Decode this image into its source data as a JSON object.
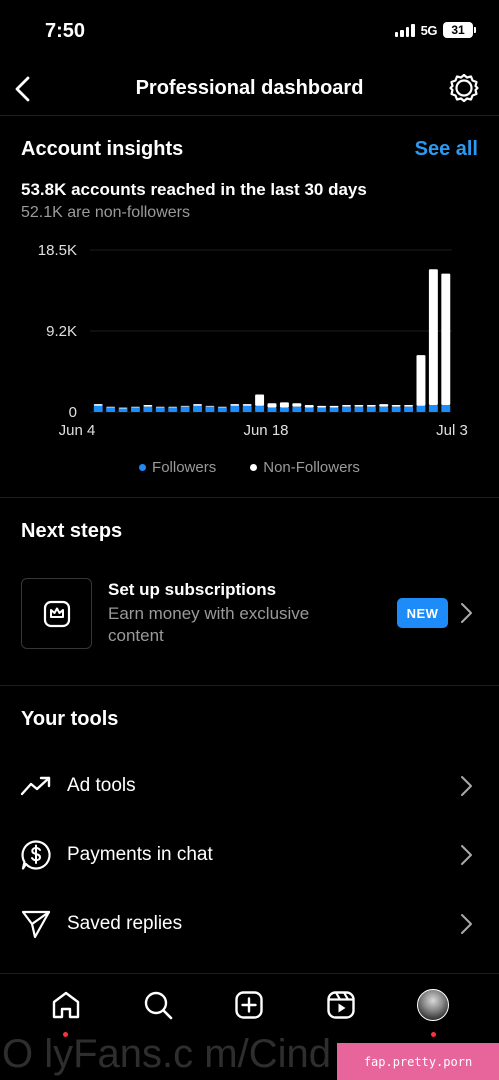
{
  "status_bar": {
    "time": "7:50",
    "network": "5G",
    "battery": "31"
  },
  "header": {
    "title": "Professional dashboard",
    "back_icon": "chevron-left-icon",
    "settings_icon": "gear-icon"
  },
  "insights": {
    "title": "Account insights",
    "see_all": "See all",
    "reach_line": "53.8K accounts reached in the last 30 days",
    "reach_sub": "52.1K are non-followers"
  },
  "chart_data": {
    "type": "bar",
    "stacked": true,
    "title": "",
    "xlabel": "",
    "ylabel": "",
    "y_ticks": [
      "18.5K",
      "9.2K",
      "0"
    ],
    "ylim": [
      0,
      18500
    ],
    "x_tick_labels": [
      "Jun 4",
      "Jun 18",
      "Jul 3"
    ],
    "categories": [
      "Jun 4",
      "Jun 5",
      "Jun 6",
      "Jun 7",
      "Jun 8",
      "Jun 9",
      "Jun 10",
      "Jun 11",
      "Jun 12",
      "Jun 13",
      "Jun 14",
      "Jun 15",
      "Jun 16",
      "Jun 17",
      "Jun 18",
      "Jun 19",
      "Jun 20",
      "Jun 21",
      "Jun 22",
      "Jun 23",
      "Jun 24",
      "Jun 25",
      "Jun 26",
      "Jun 27",
      "Jun 28",
      "Jun 29",
      "Jul 1",
      "Jul 2",
      "Jul 3"
    ],
    "colors": {
      "followers": "#1d8cf8",
      "non_followers": "#ffffff"
    },
    "series": [
      {
        "name": "Followers",
        "values": [
          700,
          500,
          400,
          500,
          600,
          500,
          500,
          600,
          700,
          600,
          500,
          700,
          700,
          700,
          500,
          500,
          600,
          500,
          500,
          500,
          600,
          600,
          600,
          600,
          600,
          600,
          700,
          800,
          800,
          700
        ]
      },
      {
        "name": "Non-Followers",
        "values": [
          200,
          100,
          100,
          100,
          200,
          100,
          100,
          100,
          200,
          100,
          100,
          200,
          200,
          1300,
          500,
          600,
          400,
          300,
          200,
          200,
          200,
          200,
          200,
          300,
          200,
          200,
          5800,
          15500,
          15000,
          16400
        ]
      }
    ],
    "legend_position": "bottom",
    "grid": true
  },
  "next_steps": {
    "title": "Next steps",
    "card_title": "Set up subscriptions",
    "card_desc": "Earn money with exclusive content",
    "badge": "NEW",
    "card_icon": "subscription-crown-icon"
  },
  "tools": {
    "title": "Your tools",
    "items": [
      {
        "label": "Ad tools",
        "icon": "trending-up-icon"
      },
      {
        "label": "Payments in chat",
        "icon": "dollar-chat-icon"
      },
      {
        "label": "Saved replies",
        "icon": "send-icon"
      }
    ]
  },
  "tab_bar": {
    "icons": [
      "home-icon",
      "search-icon",
      "create-icon",
      "reels-icon",
      "profile-avatar"
    ]
  },
  "watermark": {
    "text": "O lyFans.c m/Cind  M   7",
    "site": "fap.pretty.porn"
  }
}
